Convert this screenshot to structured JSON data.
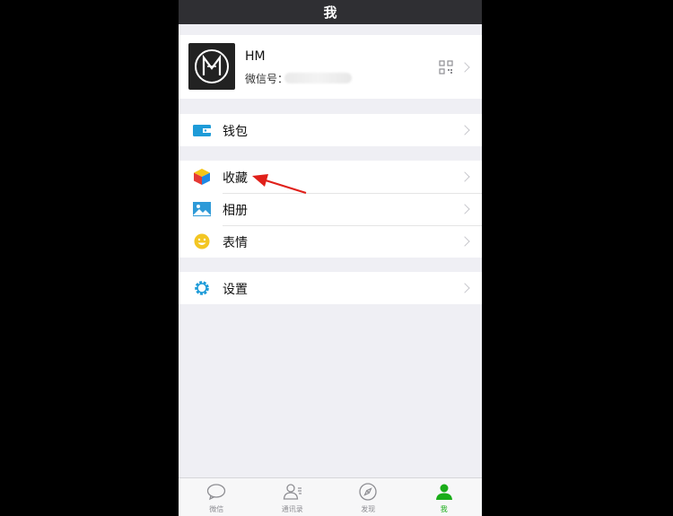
{
  "navbar": {
    "title": "我"
  },
  "profile": {
    "name": "HM",
    "wechat_id_label": "微信号：",
    "avatar_icon": "hm-logo",
    "qr_icon": "qr-code-icon"
  },
  "menu": {
    "wallet": {
      "label": "钱包",
      "icon": "wallet-icon",
      "color": "#1e9bd8"
    },
    "favorites": {
      "label": "收藏",
      "icon": "cube-icon"
    },
    "album": {
      "label": "相册",
      "icon": "album-icon",
      "color": "#2e9ad8"
    },
    "stickers": {
      "label": "表情",
      "icon": "smiley-icon",
      "color": "#f3c623"
    },
    "settings": {
      "label": "设置",
      "icon": "gear-icon",
      "color": "#1e9bd8"
    }
  },
  "tabbar": {
    "tabs": [
      {
        "label": "微信",
        "icon": "chat-bubble-icon"
      },
      {
        "label": "通讯录",
        "icon": "contacts-icon"
      },
      {
        "label": "发现",
        "icon": "compass-icon"
      },
      {
        "label": "我",
        "icon": "person-icon",
        "active": true
      }
    ],
    "active_color": "#1aad19"
  },
  "annotation": {
    "arrow_color": "#e0201a",
    "points_to": "favorites"
  }
}
